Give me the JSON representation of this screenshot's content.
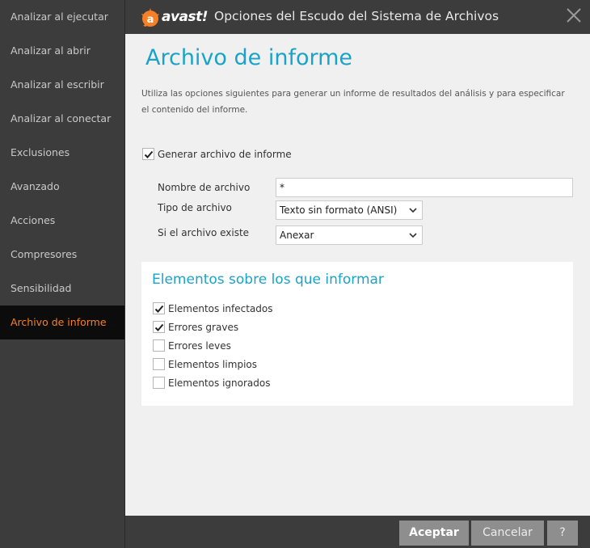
{
  "window": {
    "brand": "avast!",
    "title": "Opciones del Escudo del Sistema de Archivos"
  },
  "sidebar": {
    "items": [
      {
        "label": "Analizar al ejecutar",
        "active": false
      },
      {
        "label": "Analizar al abrir",
        "active": false
      },
      {
        "label": "Analizar al escribir",
        "active": false
      },
      {
        "label": "Analizar al conectar",
        "active": false
      },
      {
        "label": "Exclusiones",
        "active": false
      },
      {
        "label": "Avanzado",
        "active": false
      },
      {
        "label": "Acciones",
        "active": false
      },
      {
        "label": "Compresores",
        "active": false
      },
      {
        "label": "Sensibilidad",
        "active": false
      },
      {
        "label": "Archivo de informe",
        "active": true
      }
    ]
  },
  "main": {
    "title": "Archivo de informe",
    "description": "Utiliza las opciones siguientes para generar un informe de resultados del análisis y para especificar el contenido del informe.",
    "generate": {
      "label": "Generar archivo de informe",
      "checked": true
    },
    "fields": {
      "filename": {
        "label": "Nombre de archivo",
        "value": "*"
      },
      "filetype": {
        "label": "Tipo de archivo",
        "value": "Texto sin formato (ANSI)"
      },
      "exists": {
        "label": "Si el archivo existe",
        "value": "Anexar"
      }
    },
    "report_section": {
      "title": "Elementos sobre los que informar",
      "items": [
        {
          "label": "Elementos infectados",
          "checked": true
        },
        {
          "label": "Errores graves",
          "checked": true
        },
        {
          "label": "Errores leves",
          "checked": false
        },
        {
          "label": "Elementos limpios",
          "checked": false
        },
        {
          "label": "Elementos ignorados",
          "checked": false
        }
      ]
    }
  },
  "footer": {
    "accept_label": "Aceptar",
    "cancel_label": "Cancelar",
    "help_label": "?"
  },
  "colors": {
    "accent": "#1aa3c8",
    "active_item": "#f58025",
    "chrome": "#3c3c3c"
  },
  "icons": {
    "logo": "avast-logo-icon",
    "close": "close-icon",
    "check": "checkmark-icon",
    "dropdown": "chevron-down-icon"
  }
}
